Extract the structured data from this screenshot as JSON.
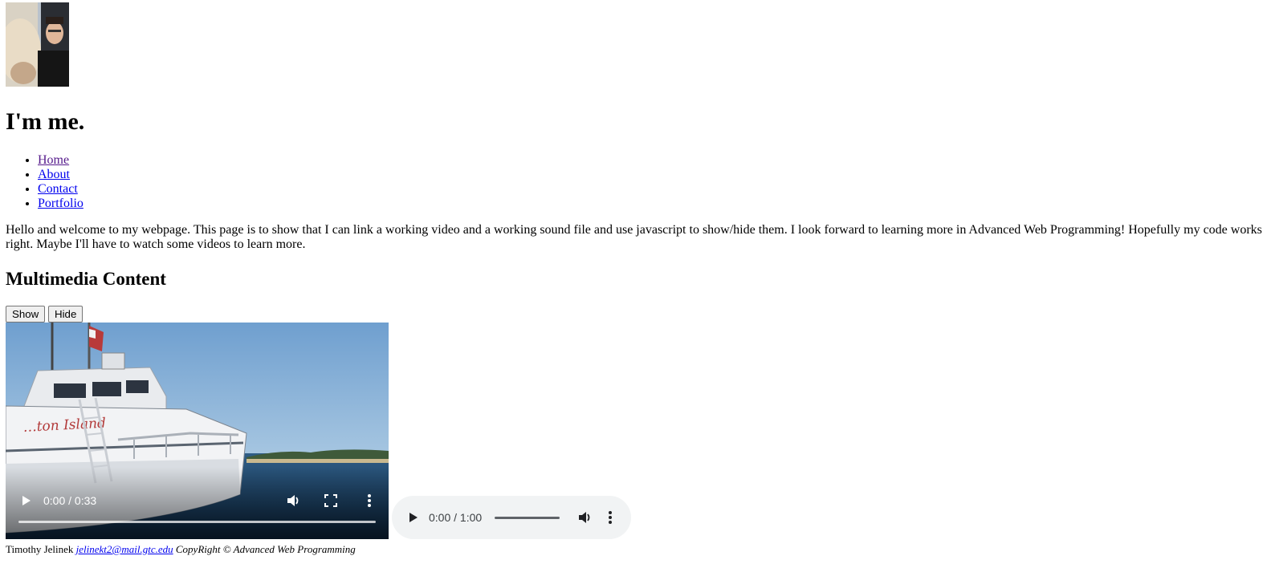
{
  "profile": {
    "image_icon": "profile-photo"
  },
  "page": {
    "title": "I'm me."
  },
  "nav": {
    "items": [
      {
        "label": "Home"
      },
      {
        "label": "About"
      },
      {
        "label": "Contact"
      },
      {
        "label": "Portfolio"
      }
    ]
  },
  "intro": {
    "text": "Hello and welcome to my webpage. This page is to show that I can link a working video and a working sound file and use javascript to show/hide them. I look forward to learning more in Advanced Web Programming! Hopefully my code works right. Maybe I'll have to watch some videos to learn more."
  },
  "multimedia": {
    "heading": "Multimedia Content",
    "show_label": "Show",
    "hide_label": "Hide"
  },
  "video": {
    "time": "0:00 / 0:33",
    "progress": 0,
    "icons": [
      "play-icon",
      "volume-icon",
      "fullscreen-icon",
      "more-options-icon"
    ],
    "boat_lettering": "…ton Island"
  },
  "audio": {
    "time": "0:00 / 1:00",
    "progress": 0,
    "icons": [
      "play-icon",
      "volume-icon",
      "more-options-icon"
    ]
  },
  "footer": {
    "author": "Timothy Jelinek",
    "email": "jelinekt2@mail.gtc.edu",
    "copyright": "CopyRight © Advanced Web Programming"
  }
}
